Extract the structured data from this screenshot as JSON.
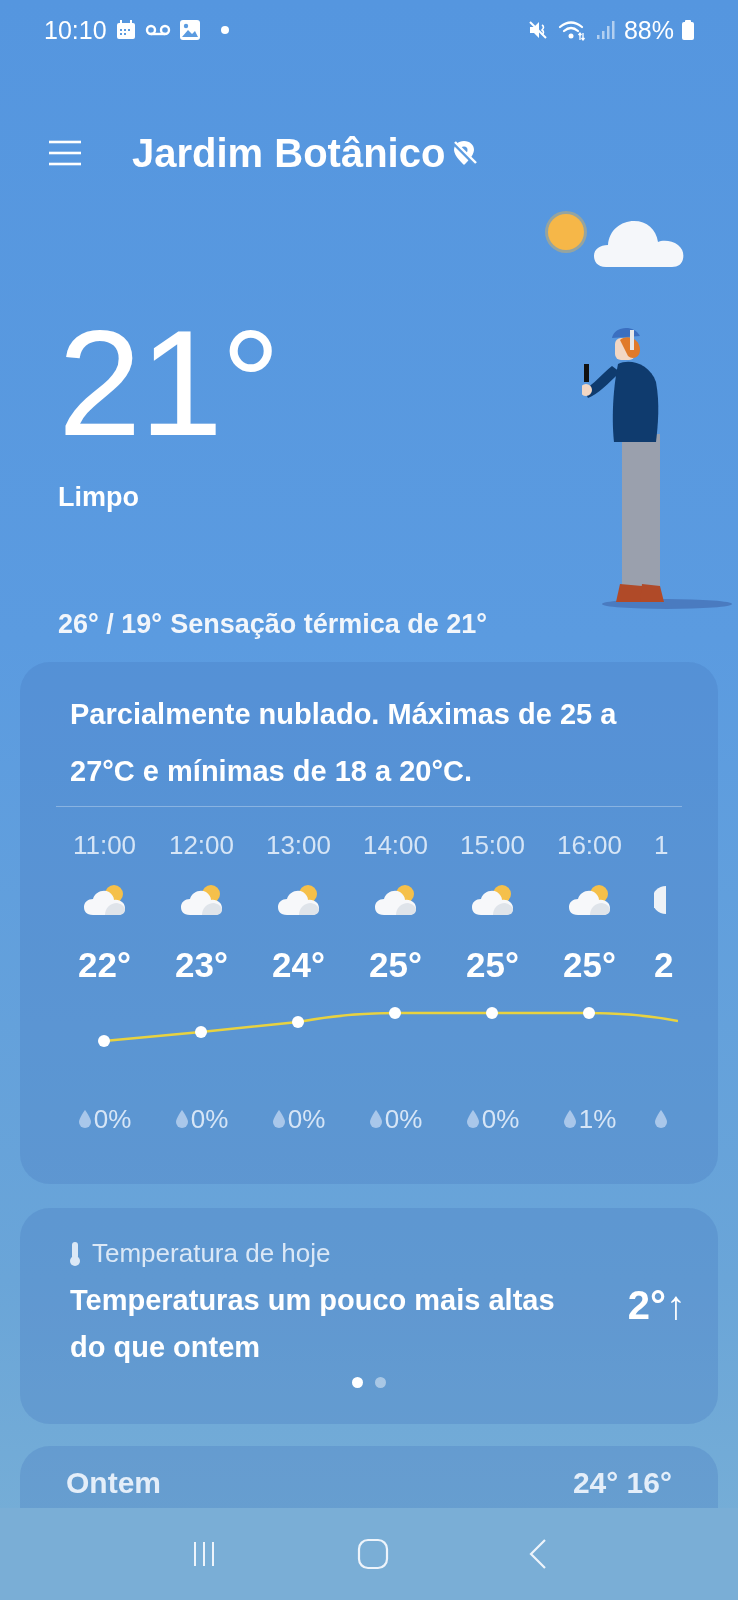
{
  "status_bar": {
    "time": "10:10",
    "battery": "88%"
  },
  "header": {
    "location": "Jardim Botânico"
  },
  "current": {
    "temperature": "21°",
    "condition": "Limpo",
    "range": "26° / 19°",
    "feels_like": "Sensação térmica de 21°"
  },
  "forecast": {
    "summary": "Parcialmente nublado. Máximas de 25 a 27°C e mínimas de 18 a 20°C.",
    "hours": [
      {
        "kind": "full",
        "time": "11:00",
        "temp": "22°",
        "precip": "0%"
      },
      {
        "kind": "full",
        "time": "12:00",
        "temp": "23°",
        "precip": "0%"
      },
      {
        "kind": "full",
        "time": "13:00",
        "temp": "24°",
        "precip": "0%"
      },
      {
        "kind": "full",
        "time": "14:00",
        "temp": "25°",
        "precip": "0%"
      },
      {
        "kind": "full",
        "time": "15:00",
        "temp": "25°",
        "precip": "0%"
      },
      {
        "kind": "full",
        "time": "16:00",
        "temp": "25°",
        "precip": "1%"
      },
      {
        "kind": "cut",
        "time": "1",
        "temp": "2"
      }
    ]
  },
  "today": {
    "label": "Temperatura de hoje",
    "text": "Temperaturas um pouco mais altas do que ontem",
    "change": "2°↑",
    "pages": [
      {
        "selected": true
      },
      {
        "selected": false
      }
    ]
  },
  "yesterday": {
    "label": "Ontem",
    "range": "24° 16°"
  }
}
